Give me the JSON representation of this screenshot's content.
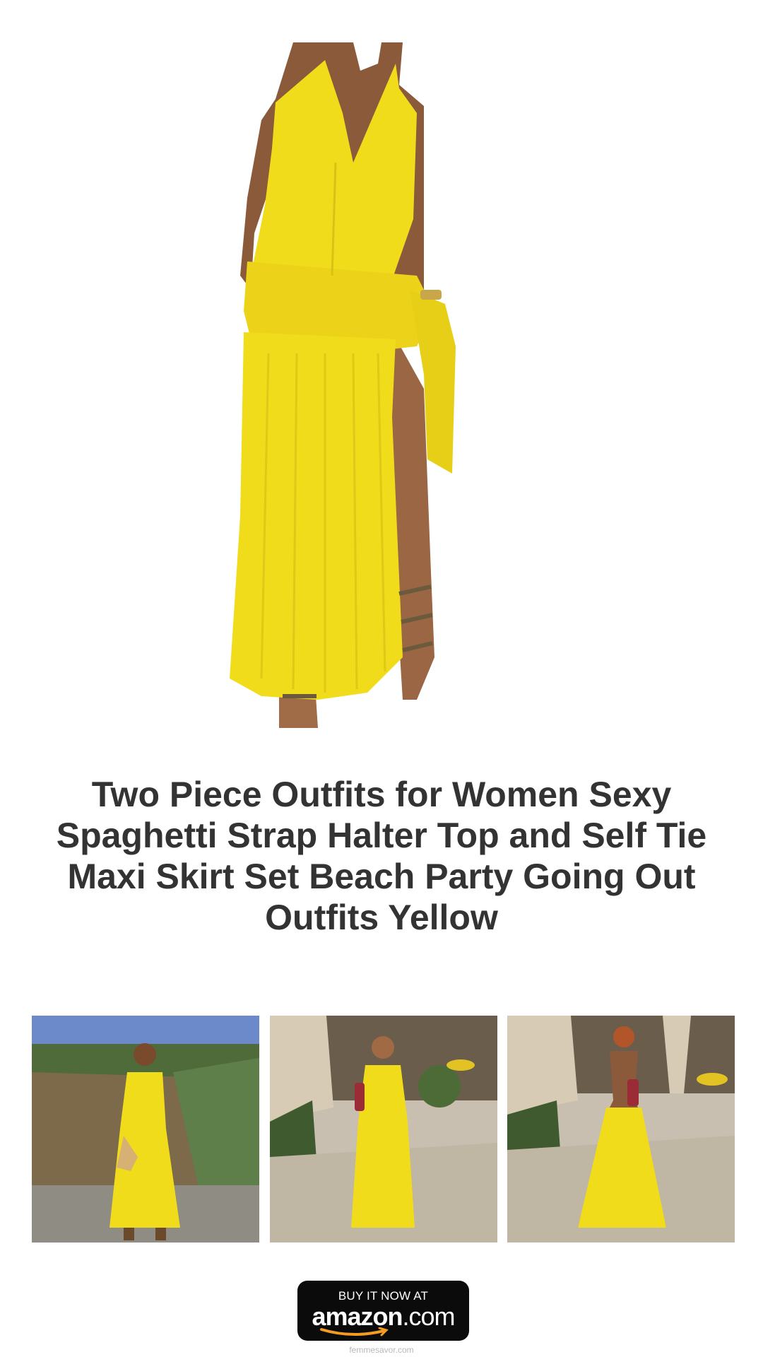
{
  "product": {
    "title": "Two Piece Outfits for Women Sexy Spaghetti Strap Halter Top and Self Tie Maxi Skirt Set Beach Party Going Out Outfits Yellow",
    "color": "Yellow",
    "accent_color": "#f1dc1c"
  },
  "thumbnails": [
    {
      "icon": "model-outdoor-photo"
    },
    {
      "icon": "model-patio-front-photo"
    },
    {
      "icon": "model-patio-back-photo"
    }
  ],
  "buy_button": {
    "top_label": "BUY IT NOW AT",
    "brand": "amazon",
    "domain": ".com",
    "background": "#0b0b0b",
    "smile_color": "#f39c1f"
  },
  "footer": {
    "site": "femmesavor.com"
  }
}
